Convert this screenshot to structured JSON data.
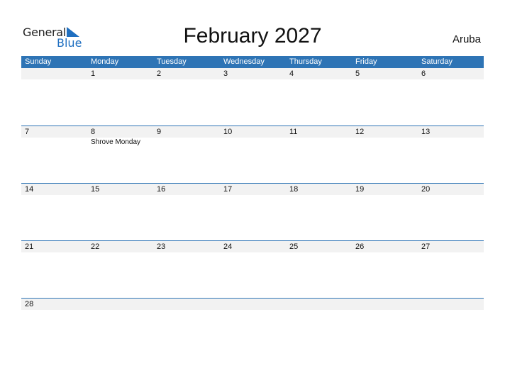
{
  "logo": {
    "general": "General",
    "blue": "Blue"
  },
  "title": "February 2027",
  "country": "Aruba",
  "colors": {
    "header_bg": "#2e74b5",
    "date_strip": "#f2f2f2",
    "brand_blue": "#1f6fc0"
  },
  "weekdays": [
    "Sunday",
    "Monday",
    "Tuesday",
    "Wednesday",
    "Thursday",
    "Friday",
    "Saturday"
  ],
  "weeks": [
    {
      "days": [
        "",
        "1",
        "2",
        "3",
        "4",
        "5",
        "6"
      ],
      "holidays": [
        "",
        "",
        "",
        "",
        "",
        "",
        ""
      ]
    },
    {
      "days": [
        "7",
        "8",
        "9",
        "10",
        "11",
        "12",
        "13"
      ],
      "holidays": [
        "",
        "Shrove Monday",
        "",
        "",
        "",
        "",
        ""
      ]
    },
    {
      "days": [
        "14",
        "15",
        "16",
        "17",
        "18",
        "19",
        "20"
      ],
      "holidays": [
        "",
        "",
        "",
        "",
        "",
        "",
        ""
      ]
    },
    {
      "days": [
        "21",
        "22",
        "23",
        "24",
        "25",
        "26",
        "27"
      ],
      "holidays": [
        "",
        "",
        "",
        "",
        "",
        "",
        ""
      ]
    },
    {
      "days": [
        "28"
      ],
      "holidays": [
        ""
      ]
    }
  ]
}
